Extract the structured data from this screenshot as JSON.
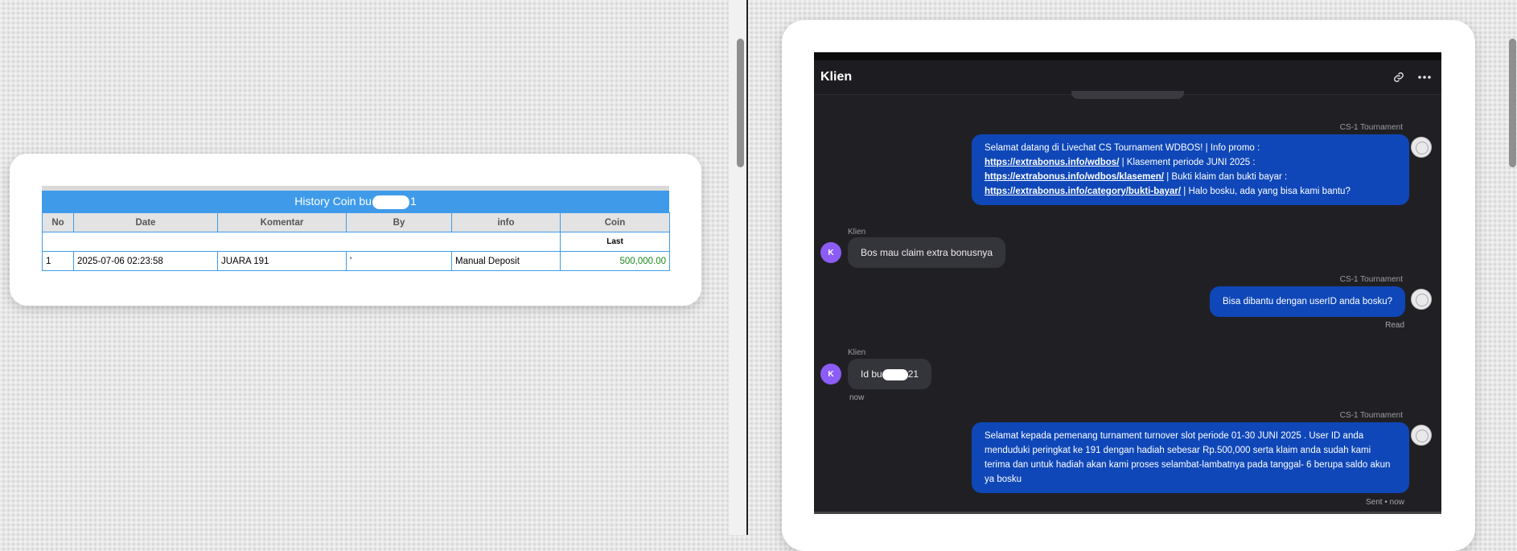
{
  "coin_history": {
    "title_prefix": "History Coin bu",
    "title_suffix": "1",
    "headers": [
      "No",
      "Date",
      "Komentar",
      "By",
      "info",
      "Coin"
    ],
    "subheader_last": "Last",
    "row": {
      "no": "1",
      "date": "2025-07-06 02:23:58",
      "komentar": "JUARA 191",
      "by": "'",
      "info": "Manual Deposit",
      "coin": "500,000.00"
    }
  },
  "chat": {
    "title": "Klien",
    "icons": {
      "link": "link-icon",
      "more": "more-icon"
    },
    "messages": [
      {
        "sender": "CS-1 Tournament",
        "parts": [
          "Selamat datang di Livechat CS Tournament WDBOS! | Info promo :",
          "https://extrabonus.info/wdbos/",
          " | Klasement periode JUNI 2025 :",
          "https://extrabonus.info/wdbos/klasemen/",
          " | Bukti klaim dan bukti bayar :",
          "https://extrabonus.info/category/bukti-bayar/",
          " | Halo bosku, ada yang bisa kami bantu?"
        ]
      },
      {
        "sender": "Klien",
        "avatar": "K",
        "text": "Bos mau claim extra bonusnya"
      },
      {
        "sender": "CS-1 Tournament",
        "text": "Bisa dibantu dengan userID anda bosku?",
        "status": "Read"
      },
      {
        "sender": "Klien",
        "avatar": "K",
        "text_prefix": "Id bu",
        "text_suffix": "21",
        "time": "now"
      },
      {
        "sender": "CS-1 Tournament",
        "text": "Selamat kepada pemenang turnament turnover slot periode 01-30 JUNI 2025 . User ID anda menduduki peringkat ke 191 dengan hadiah sebesar Rp.500,000 serta klaim anda sudah kami terima dan untuk hadiah akan kami proses selambat-lambatnya pada tanggal- 6 berupa saldo akun ya bosku",
        "status": "Sent • now"
      }
    ]
  }
}
